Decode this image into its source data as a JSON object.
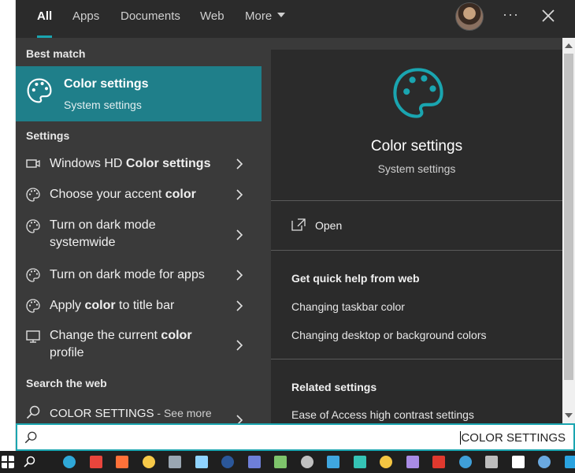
{
  "tabs": [
    {
      "label": "All",
      "active": true
    },
    {
      "label": "Apps"
    },
    {
      "label": "Documents"
    },
    {
      "label": "Web"
    },
    {
      "label": "More"
    }
  ],
  "header": {
    "more_dots": "···"
  },
  "left": {
    "best_match_label": "Best match",
    "best": {
      "title": "Color settings",
      "subtitle": "System settings",
      "icon": "palette-icon"
    },
    "settings_label": "Settings",
    "settings_items": [
      {
        "pre": "Windows HD ",
        "bold": "Color settings",
        "post": "",
        "icon": "monitor-hd-icon"
      },
      {
        "pre": "Choose your accent ",
        "bold": "color",
        "post": "",
        "icon": "palette-small-icon"
      },
      {
        "pre": "Turn on dark mode systemwide",
        "bold": "",
        "post": "",
        "icon": "palette-small-icon"
      },
      {
        "pre": "Turn on dark mode for apps",
        "bold": "",
        "post": "",
        "icon": "palette-small-icon"
      },
      {
        "pre": "Apply ",
        "bold": "color",
        "post": " to title bar",
        "icon": "palette-small-icon"
      },
      {
        "pre": "Change the current ",
        "bold": "color",
        "post": " profile",
        "icon": "display-icon"
      }
    ],
    "web_label": "Search the web",
    "web_item": {
      "query": "COLOR SETTINGS",
      "suffix": " - See more",
      "icon": "search-icon"
    }
  },
  "right": {
    "title": "Color settings",
    "subtitle": "System settings",
    "open_label": "Open",
    "help_heading": "Get quick help from web",
    "help_links": [
      "Changing taskbar color",
      "Changing desktop or background colors"
    ],
    "related_heading": "Related settings",
    "related_links": [
      "Ease of Access high contrast settings"
    ]
  },
  "search": {
    "value": "COLOR SETTINGS"
  },
  "colors": {
    "accent": "#1aa5b0",
    "highlight": "#1f7f8a",
    "panel": "#3a3a3a",
    "detail": "#2b2b2b"
  },
  "taskbar": {
    "icons": [
      {
        "name": "windows-start-icon",
        "color": "#ffffff"
      },
      {
        "name": "search-taskbar-icon",
        "color": "#ffffff"
      },
      {
        "name": "edge-icon",
        "color": "#2fa8d8"
      },
      {
        "name": "chrome-icon",
        "color": "#e8453c"
      },
      {
        "name": "firefox-icon",
        "color": "#ff7139"
      },
      {
        "name": "file-explorer-icon",
        "color": "#f7c948"
      },
      {
        "name": "camera-icon",
        "color": "#9aa6b2"
      },
      {
        "name": "notepad-icon",
        "color": "#8fd3ff"
      },
      {
        "name": "word-icon",
        "color": "#2b579a"
      },
      {
        "name": "app-blue-icon",
        "color": "#6e7fd8"
      },
      {
        "name": "app-green-icon",
        "color": "#7ec46b"
      },
      {
        "name": "calculator-icon",
        "color": "#c0c0c0"
      },
      {
        "name": "app-triangle-icon",
        "color": "#3fa7e0"
      },
      {
        "name": "app-teal-icon",
        "color": "#35c3b5"
      },
      {
        "name": "app-star-icon",
        "color": "#f4c542"
      },
      {
        "name": "app-circle-icon",
        "color": "#a98be5"
      },
      {
        "name": "app-red-icon",
        "color": "#e0392e"
      },
      {
        "name": "app-square-icon",
        "color": "#3f9fd8"
      },
      {
        "name": "app-grey-icon",
        "color": "#bdbdbd"
      },
      {
        "name": "github-icon",
        "color": "#ffffff"
      },
      {
        "name": "app-cloud-icon",
        "color": "#6aa9e0"
      },
      {
        "name": "telegram-icon",
        "color": "#2aa3e0"
      },
      {
        "name": "zoom-icon",
        "color": "#2d8cff"
      }
    ]
  }
}
